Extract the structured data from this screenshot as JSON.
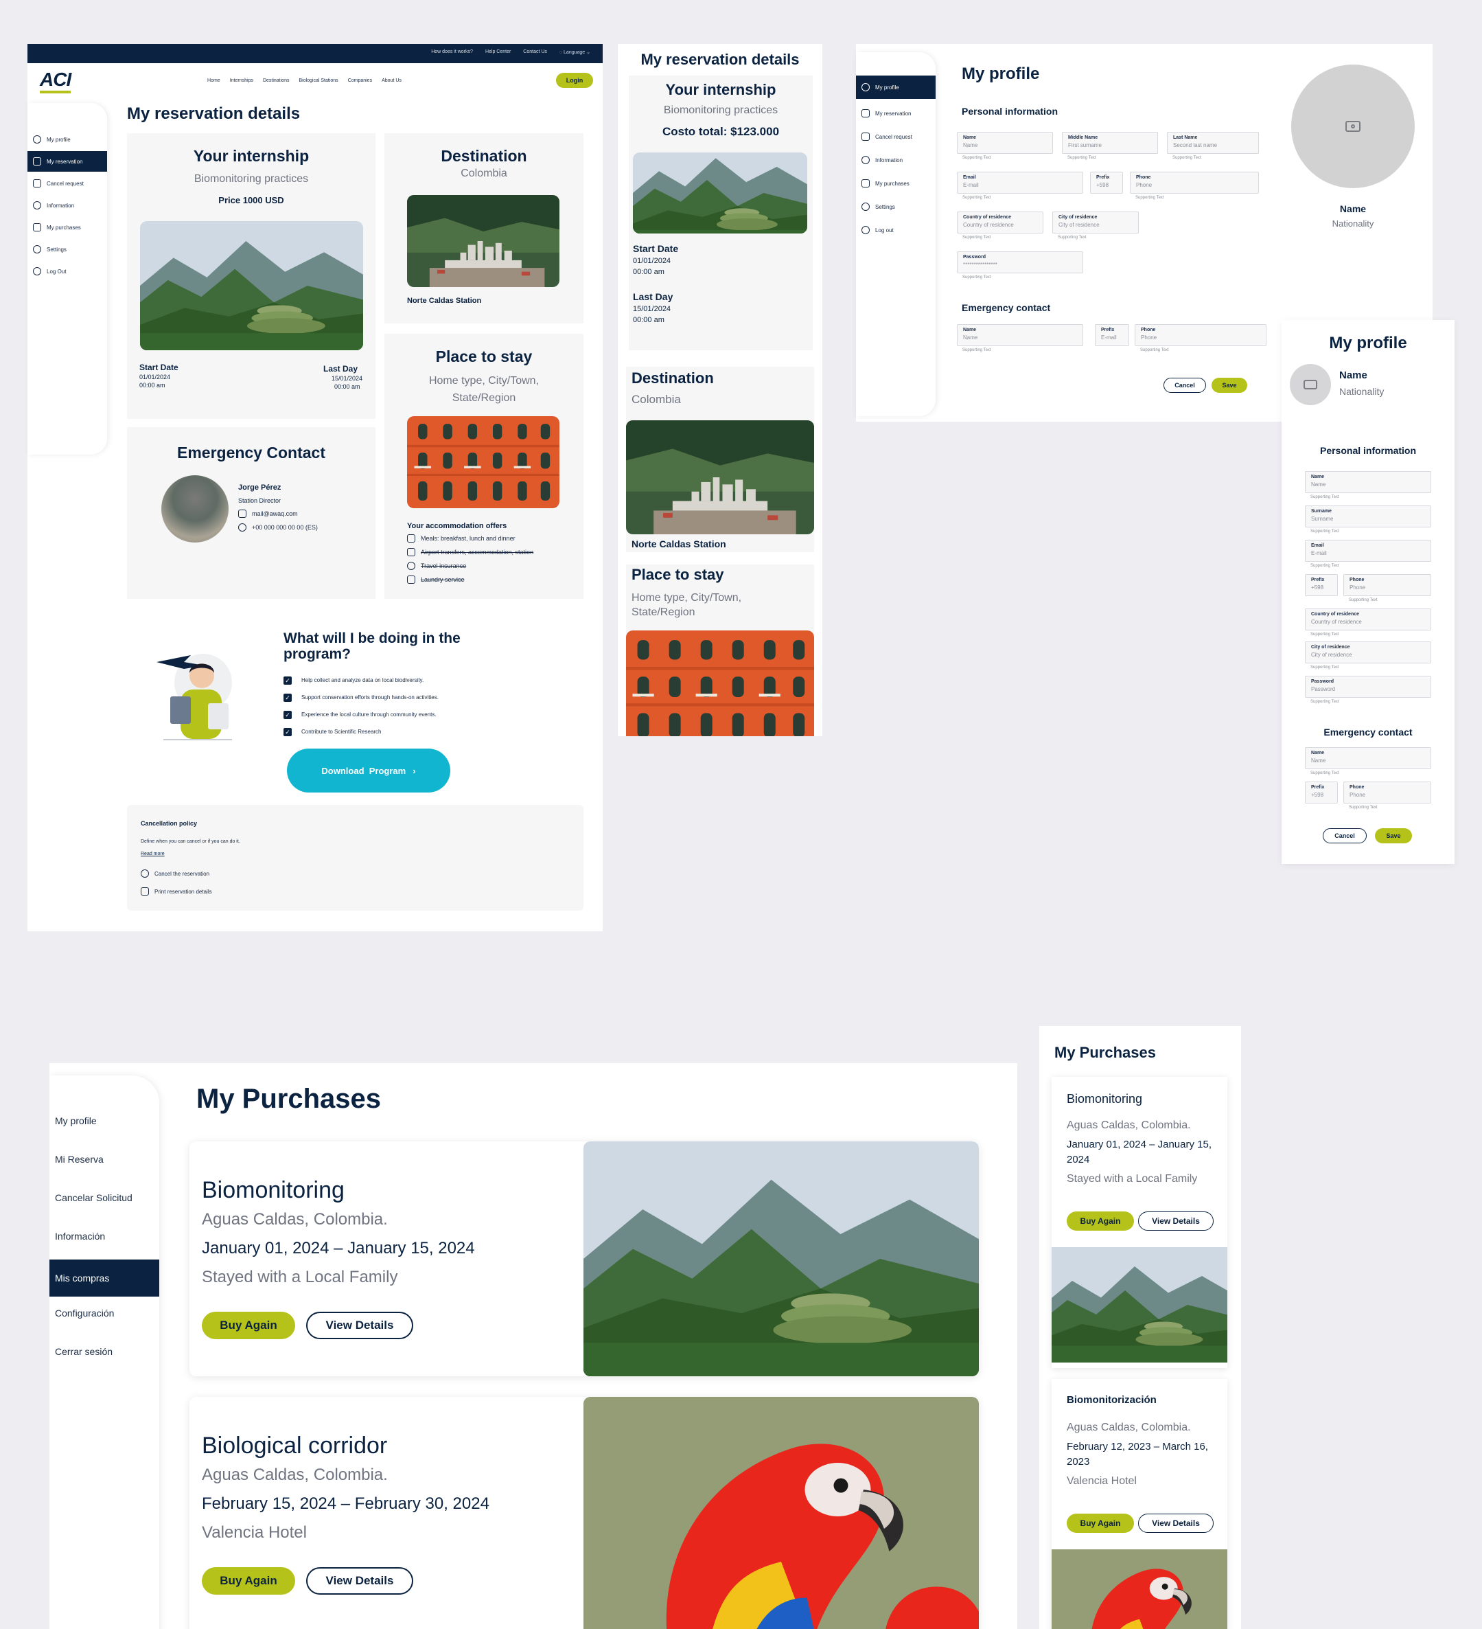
{
  "topbar": {
    "links": [
      "How does it works?",
      "Help Center",
      "Contact Us",
      "Language"
    ]
  },
  "header": {
    "logo": "ACI",
    "nav": [
      "Home",
      "Internships",
      "Destinations",
      "Biological Stations",
      "Companies",
      "About Us"
    ],
    "login": "Login"
  },
  "desktop_sidebar": [
    "My profile",
    "My reservation",
    "Cancel request",
    "Information",
    "My purchases",
    "Settings",
    "Log Out"
  ],
  "reservation": {
    "title": "My reservation details",
    "internship": {
      "title": "Your internship",
      "subtitle": "Biomonitoring practices",
      "price": "Price 1000 USD",
      "start_label": "Start Date",
      "start_date": "01/01/2024",
      "start_time": "00:00 am",
      "end_label": "Last Day",
      "end_date": "15/01/2024",
      "end_time": "00:00 am"
    },
    "destination": {
      "title": "Destination",
      "country": "Colombia",
      "station": "Norte Caldas Station"
    },
    "stay": {
      "title": "Place to stay",
      "subtitle": "Home type, City/Town, State/Region",
      "offers_title": "Your accommodation offers",
      "offers": [
        "Meals: breakfast, lunch and dinner",
        "Airport transfers, accommodation, station",
        "Travel insurance",
        "Laundry service"
      ]
    },
    "emergency": {
      "title": "Emergency Contact",
      "name": "Jorge Pérez",
      "role": "Station Director",
      "email": "mail@awaq.com",
      "phone": "+00 000 000 00 00 (ES)"
    },
    "program": {
      "title": "What will I be doing in the program?",
      "items": [
        "Help collect and analyze data on local biodiversity.",
        "Support conservation efforts through hands-on activities.",
        "Experience the local culture through community events.",
        "Contribute to Scientific Research"
      ],
      "download": "Download  Program"
    },
    "cancel": {
      "title": "Cancellation policy",
      "text": "Define when you can cancel or if you can do it.",
      "read_more": "Read more",
      "cancel_action": "Cancel the reservation",
      "print_action": "Print reservation details"
    }
  },
  "mobile_reservation": {
    "title": "My reservation details",
    "internship_title": "Your internship",
    "subtitle": "Biomonitoring practices",
    "cost": "Costo total: $123.000",
    "start_label": "Start Date",
    "start_date": "01/01/2024",
    "start_time": "00:00 am",
    "end_label": "Last Day",
    "end_date": "15/01/2024",
    "end_time": "00:00 am",
    "destination_title": "Destination",
    "country": "Colombia",
    "station": "Norte Caldas Station",
    "stay_title": "Place to stay",
    "stay_subtitle": "Home type, City/Town, State/Region"
  },
  "profile": {
    "title": "My profile",
    "sidebar": [
      "My profile",
      "My reservation",
      "Cancel request",
      "Information",
      "My purchases",
      "Settings",
      "Log out"
    ],
    "personal_title": "Personal information",
    "fields": [
      {
        "label": "Name",
        "value": "Name"
      },
      {
        "label": "Middle Name",
        "value": "First surname"
      },
      {
        "label": "Last Name",
        "value": "Second last name"
      },
      {
        "label": "Email",
        "value": "E-mail"
      },
      {
        "label": "Prefix",
        "value": "+598"
      },
      {
        "label": "Phone",
        "value": "Phone"
      },
      {
        "label": "Country of residence",
        "value": "Country of residence"
      },
      {
        "label": "City of residence",
        "value": "City of residence"
      },
      {
        "label": "Password",
        "value": "****************"
      }
    ],
    "supporting": "Supporting Text",
    "emergency_title": "Emergency contact",
    "emergency_fields": [
      {
        "label": "Name",
        "value": "Name"
      },
      {
        "label": "Prefix",
        "value": "E-mail"
      },
      {
        "label": "Phone",
        "value": "Phone"
      }
    ],
    "cancel": "Cancel",
    "save": "Save",
    "avatar_name": "Name",
    "avatar_nationality": "Nationality"
  },
  "mobile_profile": {
    "title": "My profile",
    "name": "Name",
    "nationality": "Nationality",
    "personal_title": "Personal information",
    "fields": [
      {
        "label": "Name",
        "value": "Name"
      },
      {
        "label": "Surname",
        "value": "Surname"
      },
      {
        "label": "Email",
        "value": "E-mail"
      },
      {
        "label": "Prefix",
        "value": "+598"
      },
      {
        "label": "Phone",
        "value": "Phone"
      },
      {
        "label": "Country of residence",
        "value": "Country of residence"
      },
      {
        "label": "City of residence",
        "value": "City of residence"
      },
      {
        "label": "Password",
        "value": "Password"
      }
    ],
    "supporting": "Supporting Text",
    "emergency_title": "Emergency contact",
    "emergency_fields": [
      {
        "label": "Name",
        "value": "Name"
      },
      {
        "label": "Prefix",
        "value": "+598"
      },
      {
        "label": "Phone",
        "value": "Phone"
      }
    ],
    "cancel": "Cancel",
    "save": "Save"
  },
  "purchases": {
    "title": "My Purchases",
    "sidebar": [
      "My profile",
      "Mi Reserva",
      "Cancelar Solicitud",
      "Información",
      "Mis compras",
      "Configuración",
      "Cerrar sesión"
    ],
    "items": [
      {
        "name": "Biomonitoring",
        "place": "Aguas Caldas, Colombia.",
        "dates": "January 01, 2024 – January 15, 2024",
        "stay": "Stayed with a Local Family"
      },
      {
        "name": "Biological corridor",
        "place": "Aguas Caldas, Colombia.",
        "dates": "February 15, 2024 – February 30, 2024",
        "stay": "Valencia Hotel"
      }
    ],
    "buy_again": "Buy Again",
    "view_details": "View Details"
  },
  "mobile_purchases": {
    "title": "My Purchases",
    "items": [
      {
        "name": "Biomonitoring",
        "place": "Aguas Caldas, Colombia.",
        "dates": "January 01, 2024 – January 15, 2024",
        "stay": "Stayed with a Local Family"
      },
      {
        "name": "Biomonitorización",
        "place": "Aguas Caldas, Colombia.",
        "dates": "February 12, 2023 – March 16, 2023",
        "stay": "Valencia Hotel"
      }
    ],
    "buy_again": "Buy Again",
    "view_details": "View Details"
  },
  "colors": {
    "navy": "#0b2340",
    "lime": "#b5c21a",
    "cyan": "#12b5cf",
    "background": "#eeedf2"
  }
}
